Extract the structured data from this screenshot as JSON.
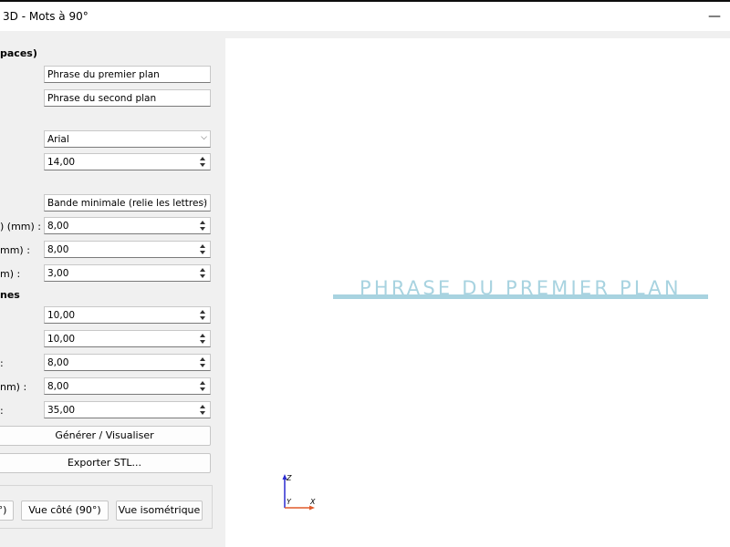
{
  "window": {
    "title": "3D - Mots à 90°",
    "minimize_glyph": "—"
  },
  "sections": {
    "phrases_header": "paces)",
    "slots_header": "nes"
  },
  "fields": {
    "phrase_front": "Phrase du premier plan",
    "phrase_back": "Phrase du second plan",
    "font": "Arial",
    "font_size": "14,00",
    "base_mode": "Bande minimale (relie les lettres)",
    "base_1": "8,00",
    "base_2": "8,00",
    "base_3": "3,00",
    "slot_1": "10,00",
    "slot_2": "10,00",
    "slot_3": "8,00",
    "slot_4": "8,00",
    "slot_5": "35,00"
  },
  "labels": {
    "base_1": ") (mm) :",
    "base_2": "mm) :",
    "base_3": "m) :",
    "slot_3": ":",
    "slot_4": "nm) :",
    "slot_5": ":"
  },
  "buttons": {
    "generate": "Générer / Visualiser",
    "export": "Exporter STL...",
    "view_front_partial": "°)",
    "view_side": "Vue côté (90°)",
    "view_iso": "Vue isométrique"
  },
  "viewport": {
    "phrase_text": "PHRASE DU PREMIER PLAN",
    "text_color": "#a8d3e0",
    "axes": {
      "z": "Z",
      "y": "Y",
      "x": "X"
    },
    "axis_colors": {
      "z": "#2a2ad0",
      "x": "#e05a2a"
    }
  }
}
